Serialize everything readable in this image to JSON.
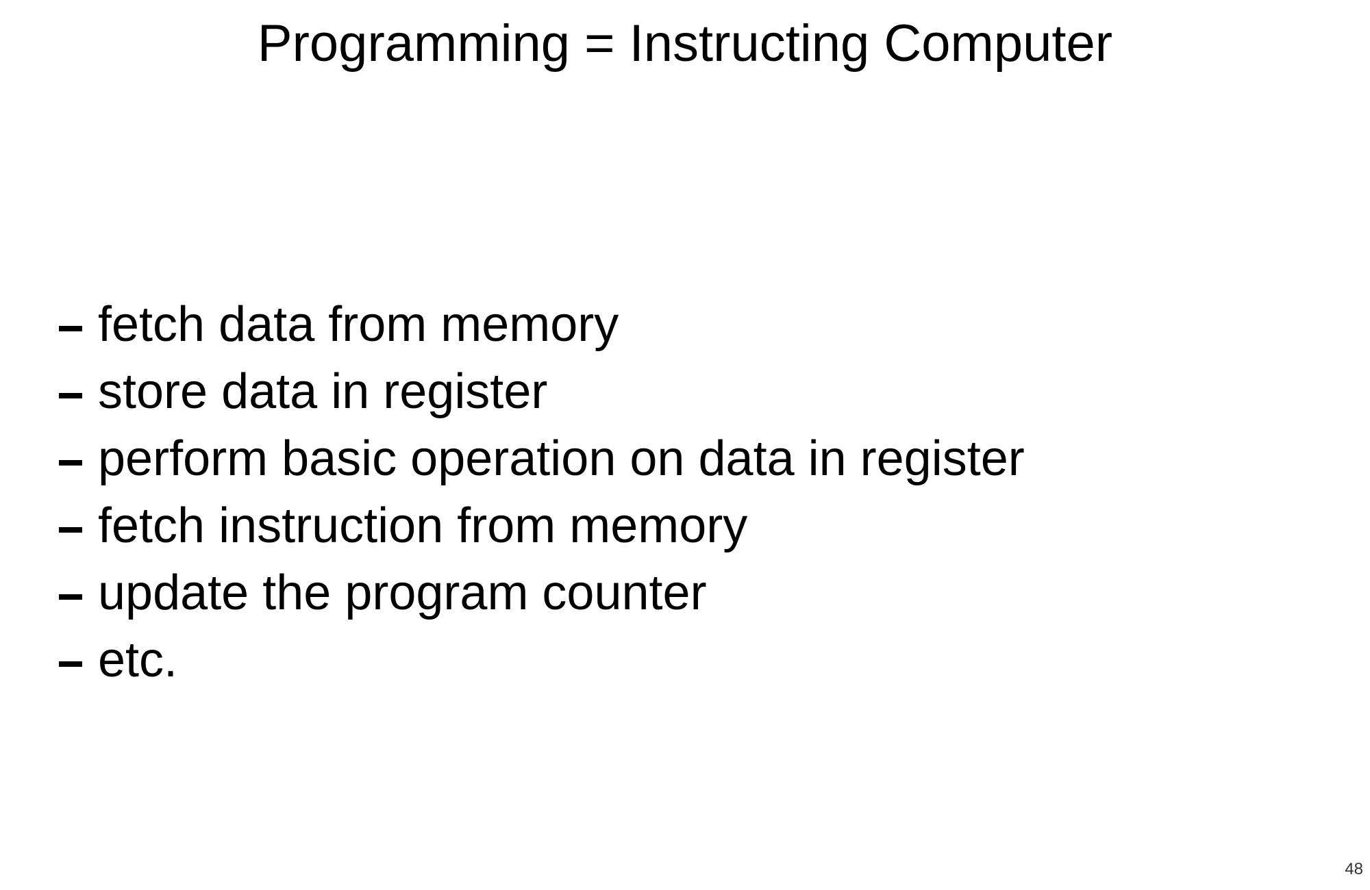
{
  "slide": {
    "title": "Programming = Instructing Computer",
    "bullet_icon": "dash-bullet-icon",
    "items": [
      {
        "text": "fetch data from memory"
      },
      {
        "text": "store data in register"
      },
      {
        "text": "perform basic operation on data in register"
      },
      {
        "text": "fetch instruction from memory"
      },
      {
        "text": "update the program counter"
      },
      {
        "text": "etc."
      }
    ],
    "page_number": "48"
  }
}
